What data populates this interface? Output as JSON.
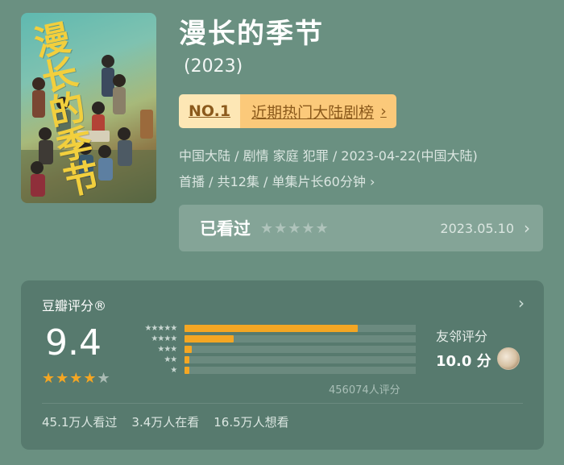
{
  "poster": {
    "art_title": "漫长的季节"
  },
  "title": "漫长的季节",
  "year": "(2023)",
  "rank": {
    "no": "NO.1",
    "label": "近期热门大陆剧榜",
    "chevron": "›"
  },
  "meta": {
    "line1": "中国大陆 / 剧情 家庭 犯罪 / 2023-04-22(中国大陆)",
    "line2": "首播 / 共12集 / 单集片长60分钟",
    "chevron": "›"
  },
  "watched": {
    "label": "已看过",
    "stars": "★★★★★",
    "date": "2023.05.10",
    "chevron": "›"
  },
  "rating": {
    "title": "豆瓣评分®",
    "chevron": "›",
    "score": "9.4",
    "stars_full": "★★★★",
    "stars_half": "★",
    "distribution": [
      {
        "stars": "★★★★★",
        "fraction": 0.74
      },
      {
        "stars": "★★★★",
        "fraction": 0.21
      },
      {
        "stars": "★★★",
        "fraction": 0.03
      },
      {
        "stars": "★★",
        "fraction": 0.02
      },
      {
        "stars": "★",
        "fraction": 0.02
      }
    ],
    "raters": "456074人评分",
    "friend_label": "友邻评分",
    "friend_score": "10.0 分"
  },
  "stats": [
    "45.1万人看过",
    "3.4万人在看",
    "16.5万人想看"
  ],
  "colors": {
    "accent": "#f4a623",
    "badge_light": "#fde7b5",
    "badge_dark": "#fbc97a"
  }
}
